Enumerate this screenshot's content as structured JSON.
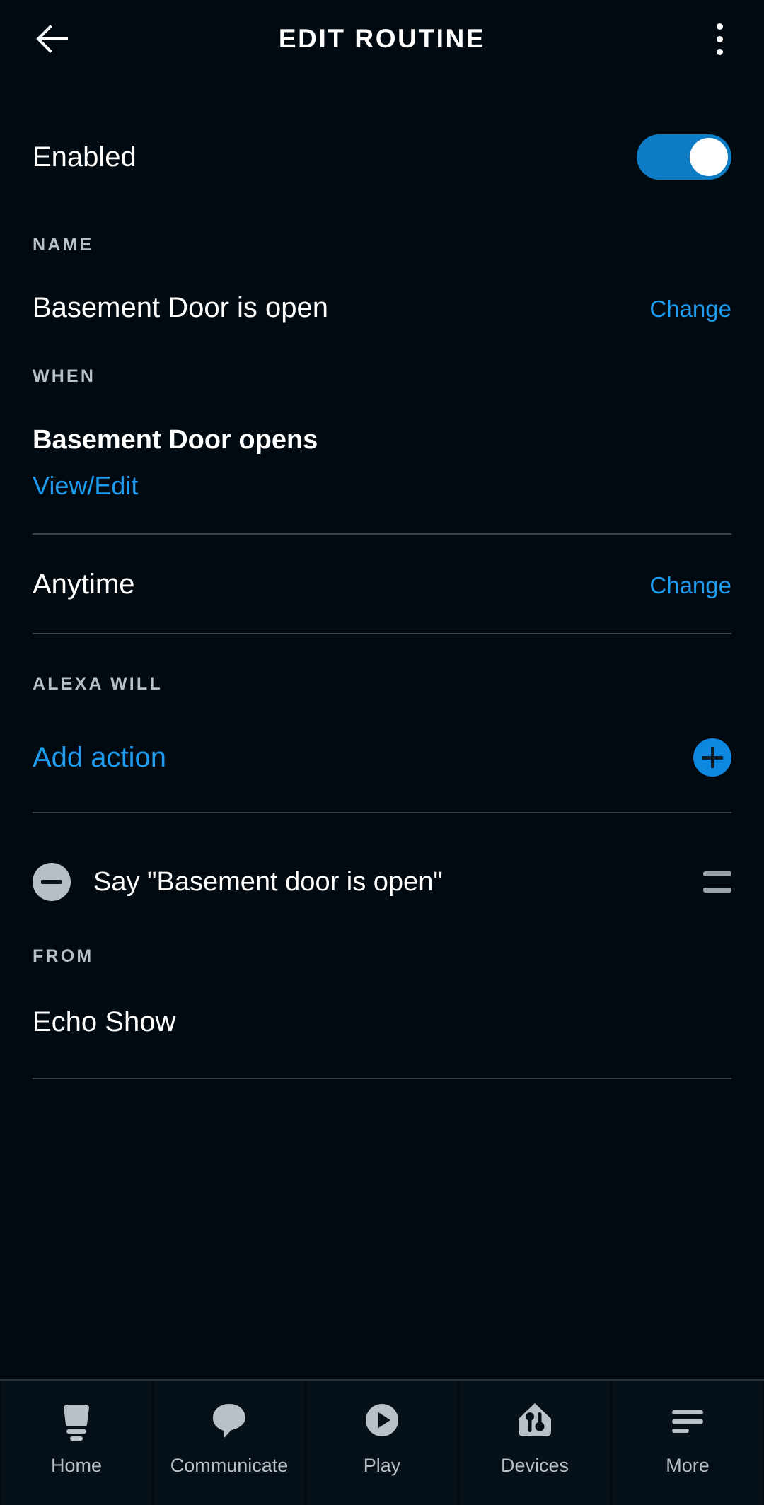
{
  "header": {
    "title": "EDIT ROUTINE",
    "back_icon": "back-arrow-icon",
    "menu_icon": "overflow-menu-icon"
  },
  "enabled": {
    "label": "Enabled",
    "toggle_state": "on",
    "toggle_color": "#0d7cc4"
  },
  "sections": {
    "name": {
      "heading": "NAME",
      "value": "Basement Door is open",
      "change_label": "Change"
    },
    "when": {
      "heading": "WHEN",
      "trigger_title": "Basement Door opens",
      "trigger_link": "View/Edit",
      "time_value": "Anytime",
      "time_change_label": "Change"
    },
    "alexa_will": {
      "heading": "ALEXA WILL",
      "add_action_label": "Add action",
      "add_icon": "plus-circle-icon",
      "actions": [
        {
          "remove_icon": "minus-circle-icon",
          "text": "Say \"Basement door is open\"",
          "drag_icon": "drag-handle-icon"
        }
      ]
    },
    "from": {
      "heading": "FROM",
      "value": "Echo Show"
    }
  },
  "colors": {
    "background": "#010a11",
    "accent_blue": "#1d9cf0",
    "toggle_blue": "#0d7cc4",
    "section_heading": "#b9c0c7",
    "divider": "#3a4148"
  },
  "bottom_nav": [
    {
      "label": "Home",
      "icon": "echo-speaker-icon"
    },
    {
      "label": "Communicate",
      "icon": "speech-bubble-icon"
    },
    {
      "label": "Play",
      "icon": "play-circle-icon"
    },
    {
      "label": "Devices",
      "icon": "smart-home-icon"
    },
    {
      "label": "More",
      "icon": "hamburger-menu-icon"
    }
  ]
}
